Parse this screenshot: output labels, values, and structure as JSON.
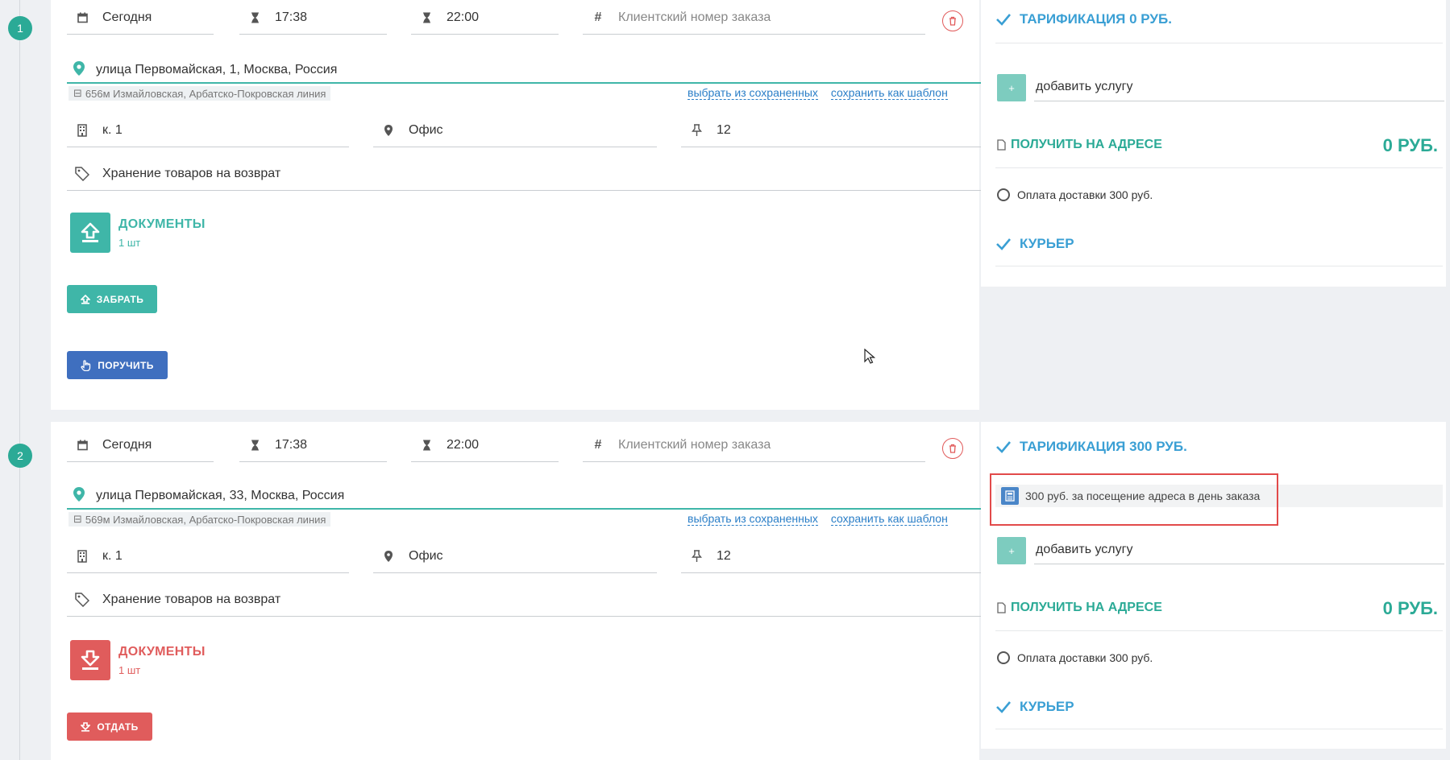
{
  "orders": [
    {
      "number": "1",
      "date": "Сегодня",
      "time_from": "17:38",
      "time_to": "22:00",
      "client_order_placeholder": "Клиентский номер заказа",
      "address": "улица Первомайская, 1, Москва, Россия",
      "metro": "656м Измайловская, Арбатско-Покровская линия",
      "link_saved": "выбрать из сохраненных",
      "link_template": "сохранить как шаблон",
      "building": "к. 1",
      "office": "Офис",
      "floor": "12",
      "comment": "Хранение товаров на возврат",
      "documents_title": "ДОКУМЕНТЫ",
      "documents_count": "1 шт",
      "documents_color": "#3fb6a8",
      "buttons": [
        {
          "label": "ЗАБРАТЬ",
          "color": "#3fb6a8",
          "icon": "upload-icon"
        },
        {
          "label": "ПОРУЧИТЬ",
          "color": "#3f6fbf",
          "icon": "hand-icon"
        }
      ]
    },
    {
      "number": "2",
      "date": "Сегодня",
      "time_from": "17:38",
      "time_to": "22:00",
      "client_order_placeholder": "Клиентский номер заказа",
      "address": "улица Первомайская, 33, Москва, Россия",
      "metro": "569м Измайловская, Арбатско-Покровская линия",
      "link_saved": "выбрать из сохраненных",
      "link_template": "сохранить как шаблон",
      "building": "к. 1",
      "office": "Офис",
      "floor": "12",
      "comment": "Хранение товаров на возврат",
      "documents_title": "ДОКУМЕНТЫ",
      "documents_count": "1 шт",
      "documents_color": "#e05c5c",
      "buttons": [
        {
          "label": "ОТДАТЬ",
          "color": "#e05c5c",
          "icon": "download-icon"
        }
      ]
    }
  ],
  "sides": [
    {
      "tariff_title": "ТАРИФИКАЦИЯ 0 РУБ.",
      "add_service": "добавить услугу",
      "receive_label": "ПОЛУЧИТЬ НА АДРЕСЕ",
      "receive_amount": "0 РУБ.",
      "payment_option": "Оплата доставки 300 руб.",
      "courier_label": "КУРЬЕР"
    },
    {
      "tariff_title": "ТАРИФИКАЦИЯ 300 РУБ.",
      "tariff_item": "300 руб. за посещение адреса в день заказа",
      "add_service": "добавить услугу",
      "receive_label": "ПОЛУЧИТЬ НА АДРЕСЕ",
      "receive_amount": "0 РУБ.",
      "payment_option": "Оплата доставки 300 руб.",
      "courier_label": "КУРЬЕР"
    }
  ],
  "colors": {
    "accent_teal": "#2baa96",
    "accent_blue": "#3a9fd4",
    "danger_red": "#e05c5c",
    "primary_blue": "#3f6fbf",
    "highlight_red": "#e24a4a"
  }
}
